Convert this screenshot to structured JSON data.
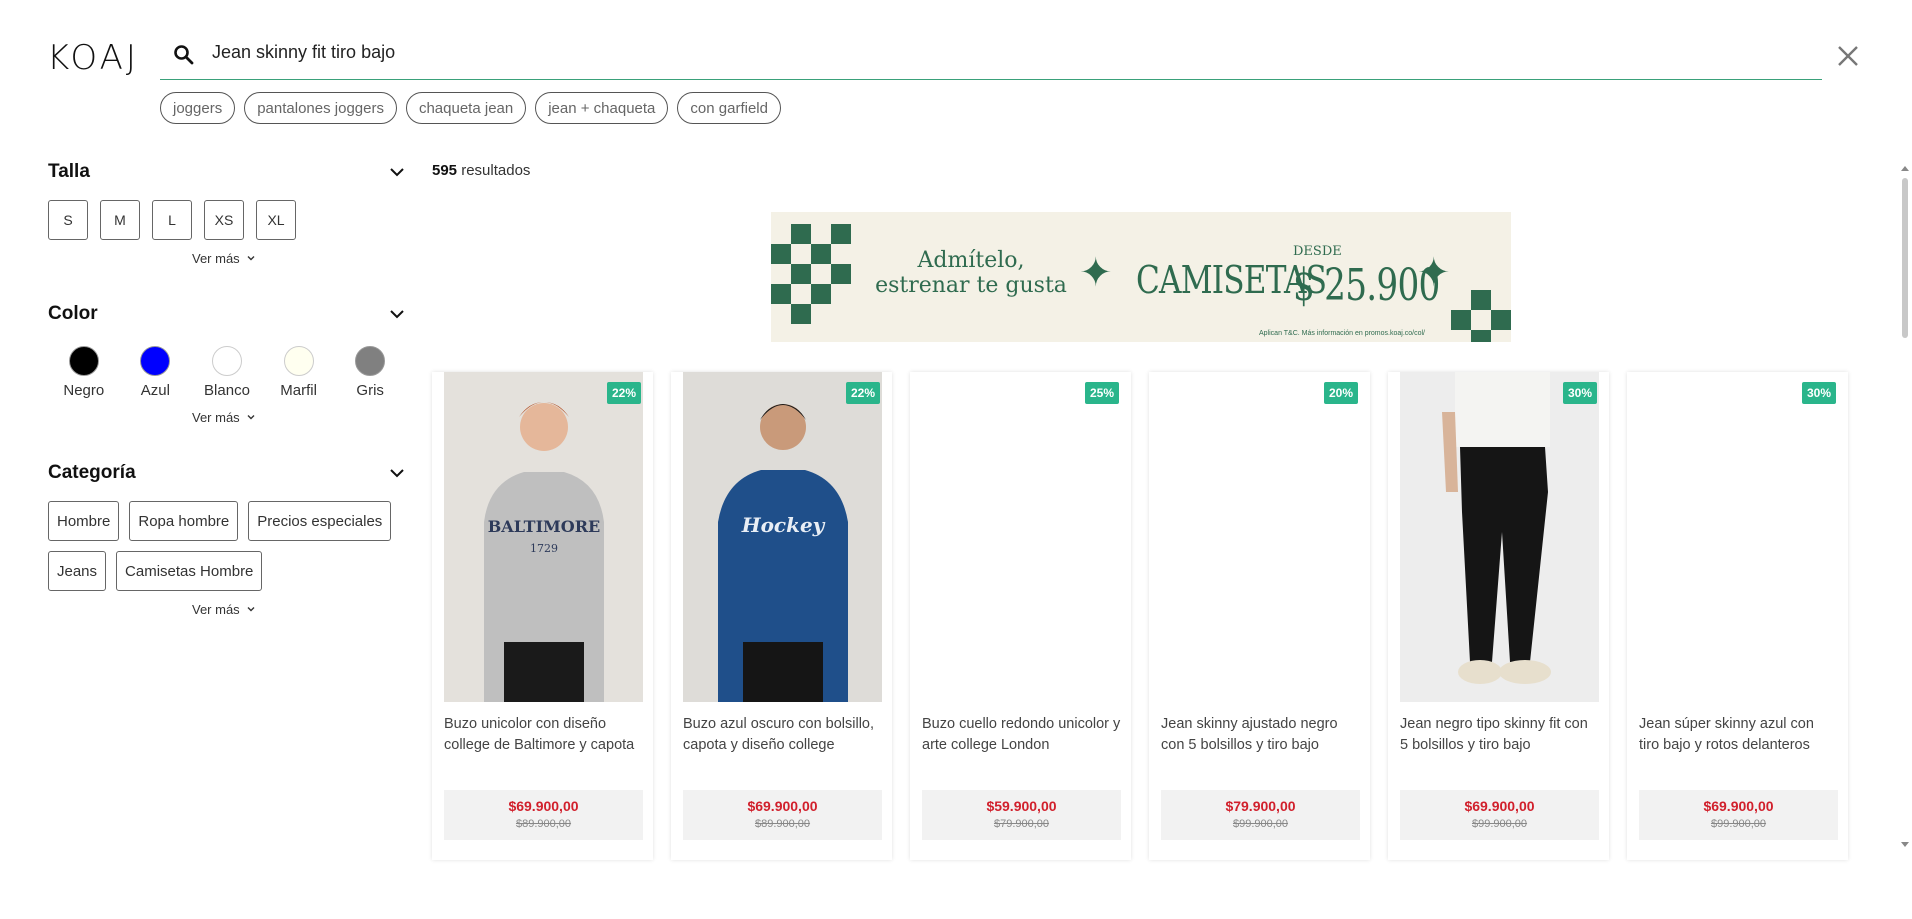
{
  "brand": {
    "logo_text": "KOAJ"
  },
  "search": {
    "value": "Jean skinny fit tiro bajo"
  },
  "suggestions": [
    "joggers",
    "pantalones joggers",
    "chaqueta jean",
    "jean + chaqueta",
    "con garfield"
  ],
  "filters": {
    "talla": {
      "title": "Talla",
      "options": [
        "S",
        "M",
        "L",
        "XS",
        "XL"
      ],
      "ver_mas": "Ver más"
    },
    "color": {
      "title": "Color",
      "options": [
        {
          "label": "Negro",
          "hex": "#000000"
        },
        {
          "label": "Azul",
          "hex": "#0000ff"
        },
        {
          "label": "Blanco",
          "hex": "#ffffff"
        },
        {
          "label": "Marfil",
          "hex": "#fffff0"
        },
        {
          "label": "Gris",
          "hex": "#808080"
        }
      ],
      "ver_mas": "Ver más"
    },
    "categoria": {
      "title": "Categoría",
      "options": [
        "Hombre",
        "Ropa hombre",
        "Precios especiales",
        "Jeans",
        "Camisetas Hombre"
      ],
      "ver_mas": "Ver más"
    }
  },
  "results": {
    "count": "595",
    "label": " resultados"
  },
  "banner": {
    "line1": "Admítelo,",
    "line2": "estrenar te gusta",
    "product": "CAMISETAS",
    "desde": "DESDE",
    "price": "$ 25.900",
    "legal": "Aplican T&C. Más información en promos.koaj.co/col/"
  },
  "products": [
    {
      "name": "Buzo unicolor con diseño college de Baltimore y capota",
      "discount": "22%",
      "price": "$69.900,00",
      "old_price": "$89.900,00",
      "image": "grey-hoodie"
    },
    {
      "name": "Buzo azul oscuro con bolsillo, capota y diseño college",
      "discount": "22%",
      "price": "$69.900,00",
      "old_price": "$89.900,00",
      "image": "blue-hoodie"
    },
    {
      "name": "Buzo cuello redondo unicolor y arte college London",
      "discount": "25%",
      "price": "$59.900,00",
      "old_price": "$79.900,00",
      "image": ""
    },
    {
      "name": "Jean skinny ajustado negro con 5 bolsillos y tiro bajo",
      "discount": "20%",
      "price": "$79.900,00",
      "old_price": "$99.900,00",
      "image": ""
    },
    {
      "name": "Jean negro tipo skinny fit con 5 bolsillos y tiro bajo",
      "discount": "30%",
      "price": "$69.900,00",
      "old_price": "$99.900,00",
      "image": "black-jeans"
    },
    {
      "name": "Jean súper skinny azul con tiro bajo y rotos delanteros",
      "discount": "30%",
      "price": "$69.900,00",
      "old_price": "$99.900,00",
      "image": ""
    }
  ],
  "colors": {
    "accent": "#2ab58b",
    "price": "#d1202c",
    "banner_green": "#2f6b4f",
    "banner_bg": "#f4f1e6"
  }
}
